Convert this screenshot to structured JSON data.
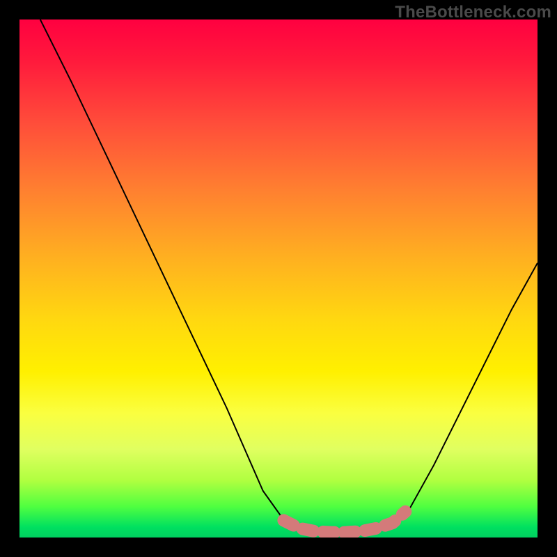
{
  "watermark": "TheBottleneck.com",
  "chart_data": {
    "type": "line",
    "title": "",
    "xlabel": "",
    "ylabel": "",
    "xlim": [
      0,
      1
    ],
    "ylim": [
      0,
      1
    ],
    "series": [
      {
        "name": "bottleneck-curve",
        "x": [
          0.04,
          0.1,
          0.2,
          0.3,
          0.4,
          0.47,
          0.52,
          0.55,
          0.58,
          0.62,
          0.68,
          0.72,
          0.75,
          0.8,
          0.88,
          0.95,
          1.0
        ],
        "y": [
          1.0,
          0.88,
          0.67,
          0.46,
          0.25,
          0.09,
          0.02,
          0.01,
          0.01,
          0.01,
          0.01,
          0.02,
          0.05,
          0.14,
          0.3,
          0.44,
          0.53
        ],
        "color": "#000000"
      },
      {
        "name": "optimal-band",
        "x": [
          0.51,
          0.54,
          0.57,
          0.6,
          0.63,
          0.66,
          0.69,
          0.72,
          0.745
        ],
        "y": [
          0.033,
          0.018,
          0.012,
          0.01,
          0.01,
          0.012,
          0.018,
          0.028,
          0.05
        ],
        "color": "#d47a7a"
      }
    ],
    "gradient_stops": [
      {
        "pos": 0.0,
        "color": "#ff0040"
      },
      {
        "pos": 0.5,
        "color": "#ffd810"
      },
      {
        "pos": 0.8,
        "color": "#faff40"
      },
      {
        "pos": 1.0,
        "color": "#00d060"
      }
    ]
  }
}
